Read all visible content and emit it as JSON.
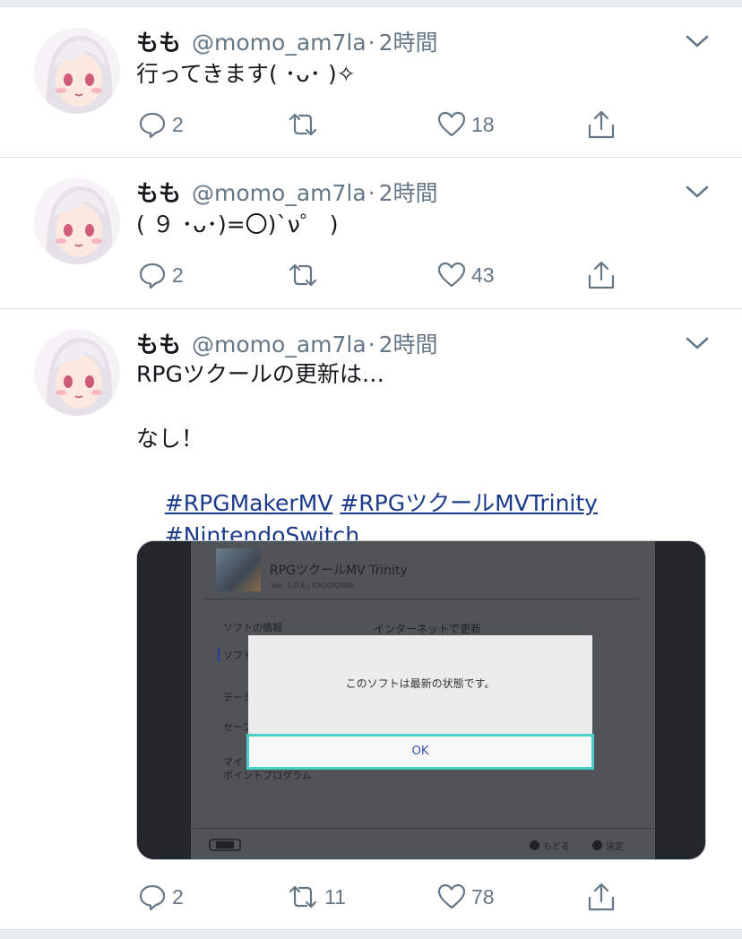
{
  "tweets": [
    {
      "name": "もも",
      "handle": "@momo_am7la",
      "separator": "·",
      "time": "2時間",
      "text": "行ってきます( ･ᴗ･ )✧",
      "replies": "2",
      "retweets": "",
      "likes": "18"
    },
    {
      "name": "もも",
      "handle": "@momo_am7la",
      "separator": "·",
      "time": "2時間",
      "text": "( ９ ･ᴗ･)=〇)`ν゜ )",
      "replies": "2",
      "retweets": "",
      "likes": "43"
    },
    {
      "name": "もも",
      "handle": "@momo_am7la",
      "separator": "·",
      "time": "2時間",
      "text_line1": "RPGツクールの更新は…",
      "text_line2": "なし！",
      "hashtags": [
        "#RPGMakerMV",
        "#RPGツクールMVTrinity",
        "#NintendoSwitch"
      ],
      "replies": "2",
      "retweets": "11",
      "likes": "78",
      "media": {
        "game_title": "RPGツクールMV Trinity",
        "game_sub": "Ver. 1.0.6 | KADOKAWA",
        "left_menu_1": "ソフトの情報",
        "left_menu_2": "ソフト",
        "left_menu_3": "データ",
        "left_menu_4": "セーブ",
        "left_menu_5": "マイ",
        "left_menu_6": "ポイントプログラム",
        "right_heading": "インターネットで更新",
        "dialog_text": "このソフトは最新の状態です。",
        "dialog_button": "OK",
        "footer_back": "もどる",
        "footer_ok": "決定"
      }
    }
  ]
}
